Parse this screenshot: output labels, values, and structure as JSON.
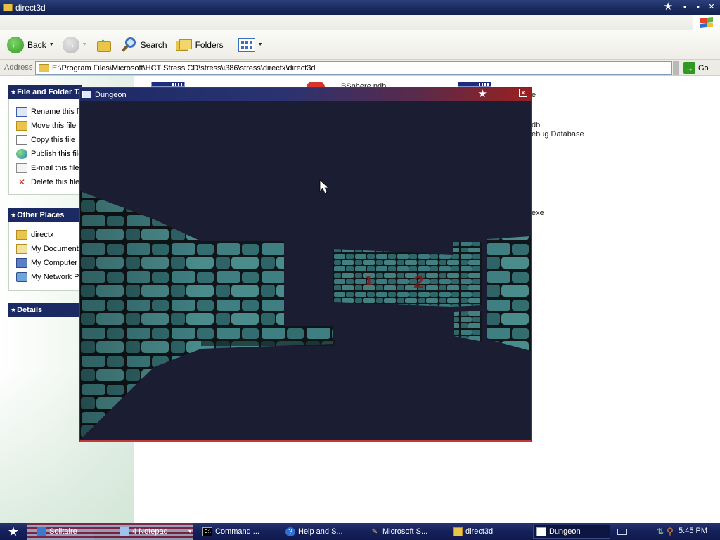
{
  "explorer": {
    "title": "direct3d",
    "toolbar": {
      "back_label": "Back",
      "search_label": "Search",
      "folders_label": "Folders"
    },
    "address": {
      "label": "Address",
      "path": "E:\\Program Files\\Microsoft\\HCT Stress CD\\stress\\i386\\stress\\directx\\direct3d",
      "go_label": "Go"
    },
    "file_tasks": {
      "heading": "File and Folder Tasks",
      "items": [
        {
          "label": "Rename this file",
          "icon": "rename-icon"
        },
        {
          "label": "Move this file",
          "icon": "move-icon"
        },
        {
          "label": "Copy this file",
          "icon": "copy-icon"
        },
        {
          "label": "Publish this file to the Web",
          "icon": "publish-icon"
        },
        {
          "label": "E-mail this file",
          "icon": "email-icon"
        },
        {
          "label": "Delete this file",
          "icon": "delete-icon"
        }
      ]
    },
    "other_places": {
      "heading": "Other Places",
      "items": [
        {
          "label": "directx",
          "icon": "folder-icon"
        },
        {
          "label": "My Documents",
          "icon": "my-documents-icon"
        },
        {
          "label": "My Computer",
          "icon": "my-computer-icon"
        },
        {
          "label": "My Network Places",
          "icon": "network-icon"
        }
      ]
    },
    "details": {
      "heading": "Details"
    },
    "files": {
      "bsphere_pdb": "BSphere.pdb",
      "frag_e1": "e",
      "frag_db": "db",
      "frag_debug": "ebug Database",
      "frag_exe": "exe"
    }
  },
  "dungeon": {
    "title": "Dungeon",
    "wall_marks": [
      "1",
      "2"
    ],
    "colors": {
      "background": "#1b1d33",
      "stone": "#3f7f82",
      "mortar": "#0f1518",
      "mark": "#7a1e1e"
    }
  },
  "taskbar": {
    "items": [
      {
        "label": "Solitaire",
        "icon": "solitaire-icon",
        "active": false
      },
      {
        "label": "4 Notepad",
        "icon": "notepad-icon",
        "active": false
      },
      {
        "label": "Command ...",
        "icon": "cmd-icon",
        "active": false
      },
      {
        "label": "Help and S...",
        "icon": "help-icon",
        "active": false
      },
      {
        "label": "Microsoft S...",
        "icon": "tool-icon",
        "active": false
      },
      {
        "label": "direct3d",
        "icon": "folder-icon",
        "active": false
      },
      {
        "label": "Dungeon",
        "icon": "window-icon",
        "active": true
      }
    ],
    "clock": "5:45 PM"
  }
}
